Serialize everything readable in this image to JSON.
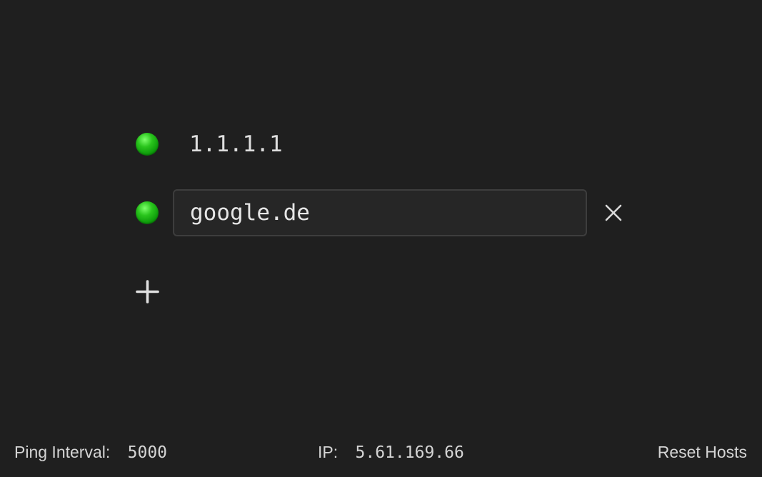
{
  "hosts": [
    {
      "label": "1.1.1.1",
      "status": "online",
      "status_color": "#1fb814",
      "editing": false
    },
    {
      "label": "google.de",
      "status": "online",
      "status_color": "#1fb814",
      "editing": true
    }
  ],
  "icons": {
    "status": "green-circle-icon",
    "remove": "close-icon",
    "add": "plus-icon"
  },
  "footer": {
    "ping_interval_label": "Ping Interval:",
    "ping_interval_value": "5000",
    "ip_label": "IP:",
    "ip_value": "5.61.169.66",
    "reset_label": "Reset Hosts"
  }
}
